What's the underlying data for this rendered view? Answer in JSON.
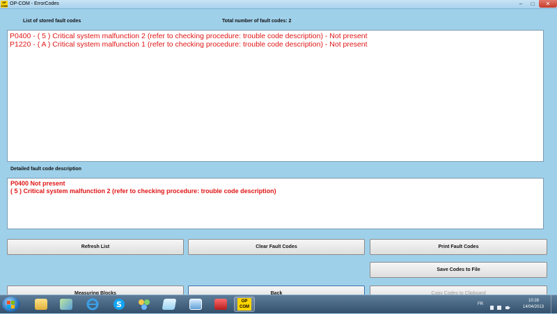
{
  "window": {
    "app_icon_text": "OP COM",
    "title": "OP-COM - ErrorCodes",
    "minimize_glyph": "–",
    "maximize_glyph": "□",
    "close_glyph": "✕"
  },
  "stored": {
    "label": "List of stored fault codes",
    "total_label": "Total number of fault codes:  2",
    "codes": [
      "P0400 - ( 5 )  Critical system malfunction 2 (refer to checking procedure: trouble code description) - Not present",
      "P1220 - ( A )  Critical system malfunction 1 (refer to checking procedure: trouble code description) - Not present"
    ]
  },
  "detail": {
    "label": "Detailed fault code description",
    "lines": [
      "P0400  Not present",
      "( 5 )  Critical system malfunction 2 (refer to checking procedure: trouble code description)"
    ]
  },
  "buttons": {
    "refresh": "Refresh List",
    "clear": "Clear Fault Codes",
    "print": "Print Fault Codes",
    "save": "Save Codes to File",
    "measuring": "Measuring Blocks",
    "back": "Back",
    "copy": "Copy Codes to Clipboard"
  },
  "taskbar": {
    "opcom_label_1": "OP",
    "opcom_label_2": "COM",
    "language": "FR",
    "time": "10:28",
    "date": "14/04/2013",
    "icons": [
      "folder-icon",
      "image-icon",
      "ie-icon",
      "skype-icon",
      "network-icon",
      "notes-icon",
      "remote-desktop-icon",
      "toolbox-icon",
      "opcom-icon"
    ]
  },
  "colors": {
    "background": "#9fd0ea",
    "fault_text": "#e01515"
  }
}
